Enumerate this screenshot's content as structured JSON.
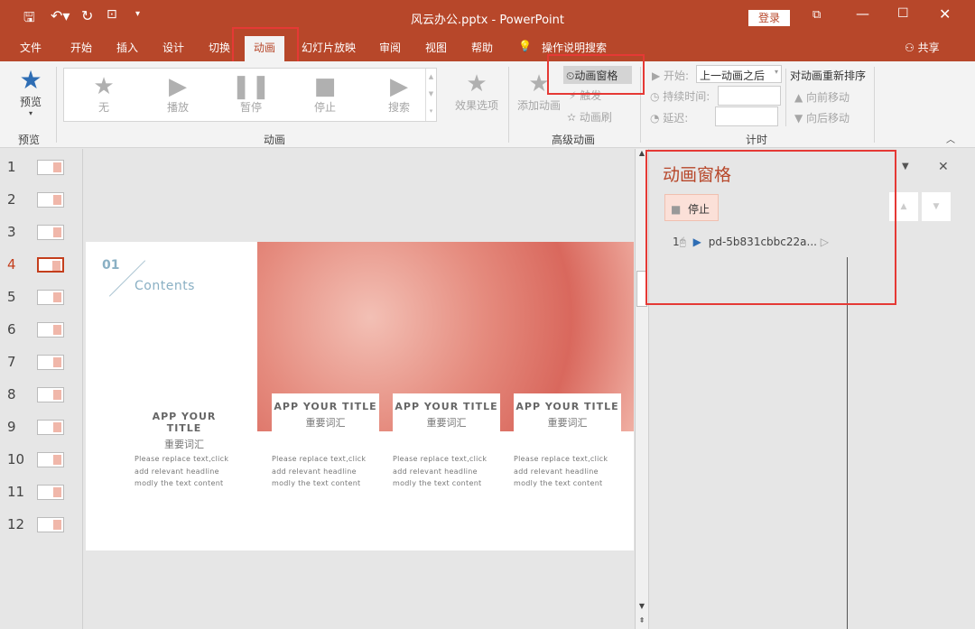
{
  "titlebar": {
    "title": "风云办公.pptx  -  PowerPoint",
    "login": "登录"
  },
  "tabs": [
    "文件",
    "开始",
    "插入",
    "设计",
    "切换",
    "动画",
    "幻灯片放映",
    "审阅",
    "视图",
    "帮助"
  ],
  "active_tab": "动画",
  "tell_me": "操作说明搜索",
  "share": "共享",
  "ribbon": {
    "preview": {
      "label": "预览",
      "group": "预览"
    },
    "gallery": [
      "无",
      "播放",
      "暂停",
      "停止",
      "搜索"
    ],
    "effect_options": "效果选项",
    "anim_group": "动画",
    "add_animation": "添加动画",
    "animation_pane": "动画窗格",
    "trigger": "触发",
    "painter": "动画刷",
    "advanced_group": "高级动画",
    "start_label": "开始:",
    "start_value": "上一动画之后",
    "duration_label": "持续时间:",
    "delay_label": "延迟:",
    "timing_group": "计时",
    "reorder": "对动画重新排序",
    "move_earlier": "向前移动",
    "move_later": "向后移动"
  },
  "thumbnails": [
    "1",
    "2",
    "3",
    "4",
    "5",
    "6",
    "7",
    "8",
    "9",
    "10",
    "11",
    "12"
  ],
  "selected_slide": "4",
  "slide": {
    "num": "01",
    "contents": "Contents",
    "cards": [
      {
        "title": "APP YOUR TITLE",
        "sub": "重要词汇",
        "desc": [
          "Please replace text,click",
          "add relevant headline",
          "modly the text content"
        ]
      },
      {
        "title": "APP YOUR TITLE",
        "sub": "重要词汇",
        "desc": [
          "Please replace text,click",
          "add relevant headline",
          "modly the text content"
        ]
      },
      {
        "title": "APP YOUR TITLE",
        "sub": "重要词汇",
        "desc": [
          "Please replace text,click",
          "add relevant headline",
          "modly the text content"
        ]
      },
      {
        "title": "APP YOUR TITLE",
        "sub": "重要词汇",
        "desc": [
          "Please replace text,click",
          "add relevant headline",
          "modly the text content"
        ]
      }
    ]
  },
  "pane": {
    "title": "动画窗格",
    "stop": "停止",
    "item_index": "1",
    "item_name": "pd-5b831cbbc22a..."
  },
  "colors": {
    "accent": "#b7472a",
    "highlight": "#e53935"
  }
}
